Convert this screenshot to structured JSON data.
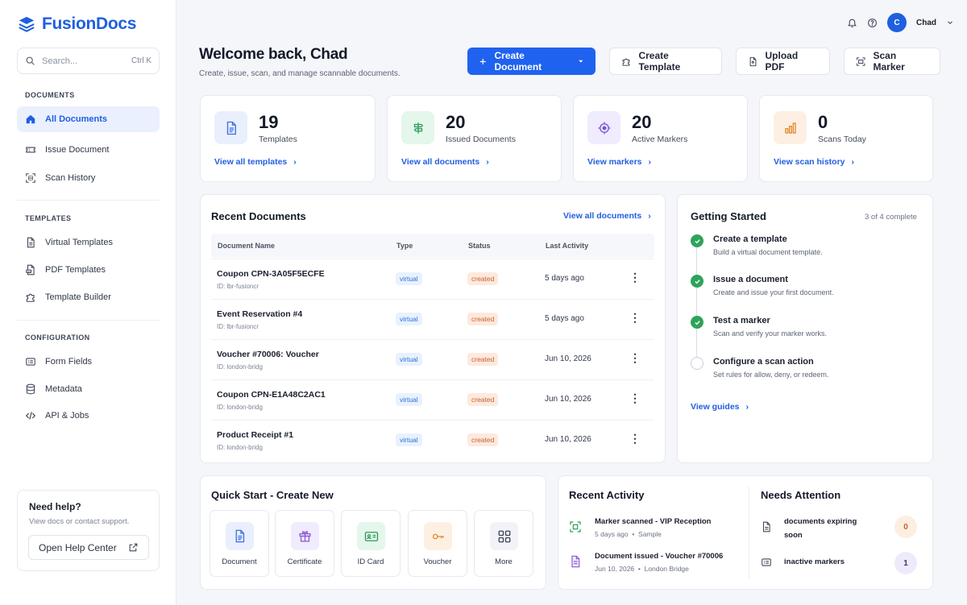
{
  "app": {
    "name": "FusionDocs",
    "brand_color": "#1f5fe0"
  },
  "search": {
    "placeholder": "Search...",
    "shortcut": "Ctrl K"
  },
  "sidebar": {
    "sections": [
      {
        "label": "DOCUMENTS",
        "items": [
          {
            "label": "All Documents",
            "icon": "home-icon",
            "active": true
          },
          {
            "label": "Issue Document",
            "icon": "ticket-icon"
          },
          {
            "label": "Scan History",
            "icon": "scan-icon"
          }
        ]
      },
      {
        "label": "TEMPLATES",
        "items": [
          {
            "label": "Virtual Templates",
            "icon": "file-icon"
          },
          {
            "label": "PDF Templates",
            "icon": "pdf-icon"
          },
          {
            "label": "Template Builder",
            "icon": "puzzle-icon"
          }
        ]
      },
      {
        "label": "CONFIGURATION",
        "items": [
          {
            "label": "Form Fields",
            "icon": "form-icon"
          },
          {
            "label": "Metadata",
            "icon": "database-icon"
          },
          {
            "label": "API & Jobs",
            "icon": "code-icon"
          }
        ]
      }
    ],
    "help": {
      "title": "Need help?",
      "text": "View docs or contact support.",
      "button": "Open Help Center"
    }
  },
  "user": {
    "initial": "C",
    "name": "Chad"
  },
  "header": {
    "title": "Welcome back, Chad",
    "subtitle": "Create, issue, scan, and manage scannable documents.",
    "primary_button": "Create Document",
    "buttons": [
      "Create Template",
      "Upload PDF",
      "Scan Marker"
    ]
  },
  "stats": [
    {
      "value": "19",
      "label": "Templates",
      "link": "View all templates",
      "icon": "document-icon",
      "bg": "#e9effd",
      "color": "#3a6fe0"
    },
    {
      "value": "20",
      "label": "Issued Documents",
      "link": "View all documents",
      "icon": "signpost-icon",
      "bg": "#e5f6ec",
      "color": "#2f9a5a"
    },
    {
      "value": "20",
      "label": "Active Markers",
      "link": "View markers",
      "icon": "target-icon",
      "bg": "#f0ebfd",
      "color": "#7b55d6"
    },
    {
      "value": "0",
      "label": "Scans Today",
      "link": "View scan history",
      "icon": "bar-chart-icon",
      "bg": "#fdf0e2",
      "color": "#e08a2f"
    }
  ],
  "recent_documents": {
    "title": "Recent Documents",
    "link": "View all documents",
    "columns": [
      "Document Name",
      "Type",
      "Status",
      "Last Activity"
    ],
    "rows": [
      {
        "name": "Coupon CPN-3A05F5ECFE",
        "id": "ID: lbr-fusioncr",
        "type": "virtual",
        "status": "created",
        "activity": "5 days ago"
      },
      {
        "name": "Event Reservation #4",
        "id": "ID: lbr-fusioncr",
        "type": "virtual",
        "status": "created",
        "activity": "5 days ago"
      },
      {
        "name": "Voucher #70006: Voucher",
        "id": "ID: london-bridg",
        "type": "virtual",
        "status": "created",
        "activity": "Jun 10, 2026"
      },
      {
        "name": "Coupon CPN-E1A48C2AC1",
        "id": "ID: london-bridg",
        "type": "virtual",
        "status": "created",
        "activity": "Jun 10, 2026"
      },
      {
        "name": "Product Receipt #1",
        "id": "ID: london-bridg",
        "type": "virtual",
        "status": "created",
        "activity": "Jun 10, 2026"
      }
    ]
  },
  "getting_started": {
    "title": "Getting Started",
    "progress": "3 of 4 complete",
    "steps": [
      {
        "title": "Create a template",
        "desc": "Build a virtual document template.",
        "done": true
      },
      {
        "title": "Issue a document",
        "desc": "Create and issue your first document.",
        "done": true
      },
      {
        "title": "Test a marker",
        "desc": "Scan and verify your marker works.",
        "done": true
      },
      {
        "title": "Configure a scan action",
        "desc": "Set rules for allow, deny, or redeem.",
        "done": false
      }
    ],
    "link": "View guides"
  },
  "quick_start": {
    "title": "Quick Start - Create New",
    "tiles": [
      {
        "label": "Document",
        "icon": "document-icon",
        "bg": "#e9effd",
        "color": "#3a6fe0"
      },
      {
        "label": "Certificate",
        "icon": "gift-icon",
        "bg": "#f0ebfd",
        "color": "#8a5ad6"
      },
      {
        "label": "ID Card",
        "icon": "id-card-icon",
        "bg": "#e5f6ec",
        "color": "#2f9a5a"
      },
      {
        "label": "Voucher",
        "icon": "key-icon",
        "bg": "#fdf0e2",
        "color": "#e08a2f"
      },
      {
        "label": "More",
        "icon": "grid-icon",
        "bg": "#f1f3f7",
        "color": "#3d4557"
      }
    ]
  },
  "recent_activity": {
    "title": "Recent Activity",
    "items": [
      {
        "title": "Marker scanned - VIP Reception",
        "time": "5 days ago",
        "source": "Sample",
        "icon": "scan-icon",
        "color": "#2f9a5a"
      },
      {
        "title": "Document issued - Voucher #70006",
        "time": "Jun 10, 2026",
        "source": "London Bridge",
        "icon": "document-icon",
        "color": "#8a5ad6"
      }
    ]
  },
  "needs_attention": {
    "title": "Needs Attention",
    "items": [
      {
        "label": "documents expiring soon",
        "count": "0",
        "icon": "file-icon",
        "bg": "#fdeee2",
        "color": "#c7632c"
      },
      {
        "label": "inactive markers",
        "count": "1",
        "icon": "marker-icon",
        "bg": "#efeafb",
        "color": "#3d3470"
      }
    ]
  }
}
